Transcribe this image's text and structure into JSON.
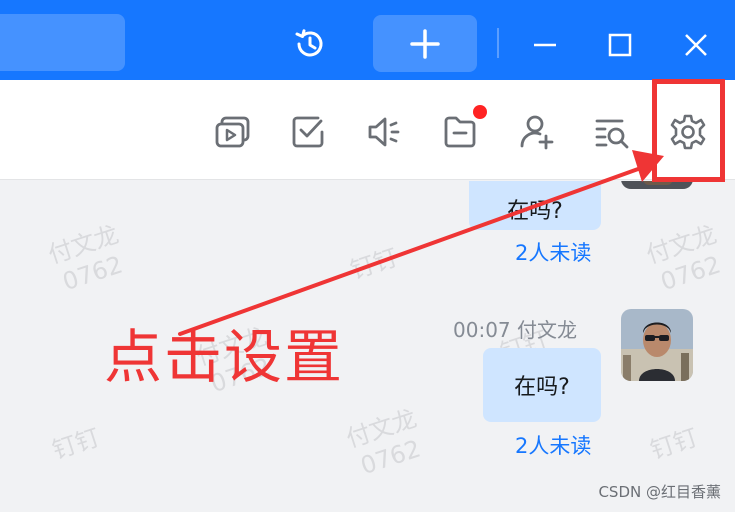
{
  "titlebar": {
    "icons": [
      "history-icon",
      "plus-icon",
      "minimize-icon",
      "maximize-icon",
      "close-icon"
    ]
  },
  "toolbar": {
    "icons": [
      "screen-share-icon",
      "task-check-icon",
      "voice-icon",
      "folder-icon",
      "add-member-icon",
      "search-history-icon",
      "settings-icon"
    ],
    "notification_dot_color": "#ff2323"
  },
  "messages": [
    {
      "text": "在吗?",
      "unread": "2人未读"
    },
    {
      "time": "00:07",
      "sender": "付文龙",
      "text": "在吗?",
      "unread": "2人未读"
    }
  ],
  "watermarks": [
    "付文龙\n0762",
    "钉钉",
    "付文龙\n0762",
    "钉钉",
    "付文龙\n0762",
    "钉钉",
    "付文龙\n0762",
    "钉钉"
  ],
  "annotation": {
    "text": "点击设置",
    "color": "#ef3535"
  },
  "credit": "CSDN @红目香薰",
  "colors": {
    "brand": "#1677ff",
    "bubble": "#cfe5ff"
  }
}
